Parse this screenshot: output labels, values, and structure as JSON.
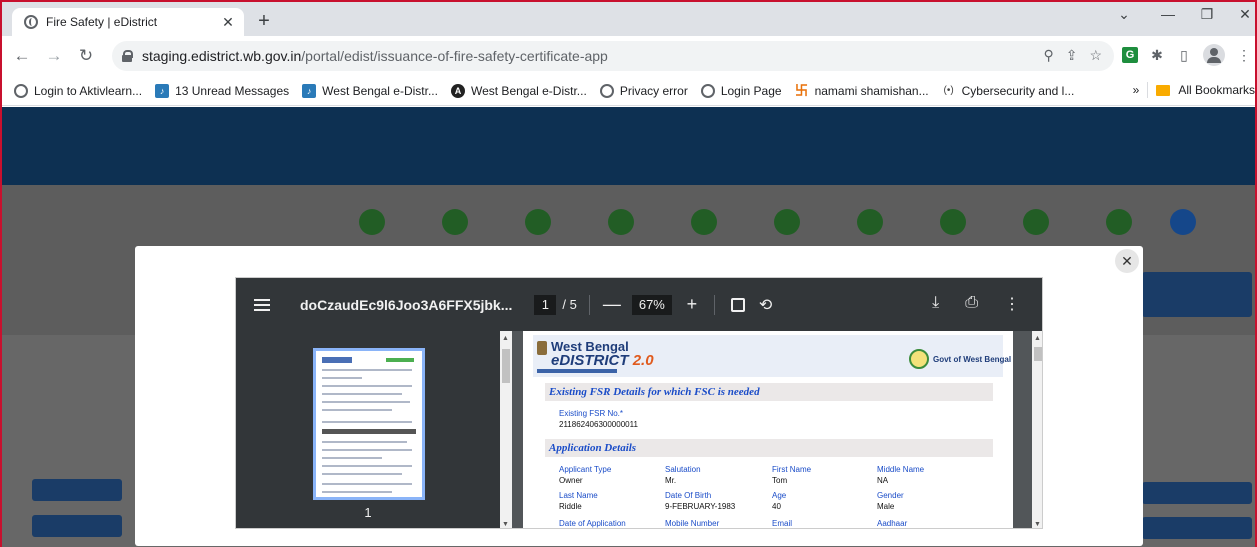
{
  "browser": {
    "tab_title": "Fire Safety | eDistrict",
    "url_host": "staging.edistrict.wb.gov.in",
    "url_path": "/portal/edist/issuance-of-fire-safety-certificate-app",
    "bookmarks": [
      {
        "label": "Login to Aktivlearn...",
        "icon": "globe-icon"
      },
      {
        "label": "13 Unread Messages",
        "icon": "music-icon"
      },
      {
        "label": "West Bengal e-Distr...",
        "icon": "music-icon"
      },
      {
        "label": "West Bengal e-Distr...",
        "icon": "angular-icon"
      },
      {
        "label": "Privacy error",
        "icon": "globe-icon"
      },
      {
        "label": "Login Page",
        "icon": "globe-icon"
      },
      {
        "label": "namami shamishan...",
        "icon": "hindi-logo-icon"
      },
      {
        "label": "Cybersecurity and l...",
        "icon": "cyber-icon"
      }
    ],
    "all_bookmarks_label": "All Bookmarks",
    "overflow_chevron": "»"
  },
  "pdf_viewer": {
    "doc_name": "doCzaudEc9l6Joo3A6FFX5jbk...",
    "current_page": "1",
    "total_pages": "/ 5",
    "zoom": "67%",
    "thumbnail_page": "1"
  },
  "document": {
    "brand_line1": "West Bengal",
    "brand_line2_prefix": "eDISTRICT",
    "brand_line2_version": "2.0",
    "govt_label": "Govt of West Bengal",
    "section1_title": "Existing FSR Details for which FSC is needed",
    "fsr_label": "Existing FSR No.*",
    "fsr_value": "211862406300000011",
    "section2_title": "Application Details",
    "fields": [
      {
        "label": "Applicant Type",
        "value": "Owner"
      },
      {
        "label": "Salutation",
        "value": "Mr."
      },
      {
        "label": "First Name",
        "value": "Tom"
      },
      {
        "label": "Middle Name",
        "value": "NA"
      },
      {
        "label": "Last Name",
        "value": "Riddle"
      },
      {
        "label": "Date Of Birth",
        "value": "9-FEBRUARY-1983"
      },
      {
        "label": "Age",
        "value": "40"
      },
      {
        "label": "Gender",
        "value": "Male"
      },
      {
        "label": "Date of Application",
        "value": ""
      },
      {
        "label": "Mobile Number",
        "value": ""
      },
      {
        "label": "Email",
        "value": ""
      },
      {
        "label": "Aadhaar",
        "value": ""
      }
    ]
  },
  "colors": {
    "frame_border": "#c8102e",
    "pdf_toolbar": "#323639",
    "section_title": "#1a4cc8"
  }
}
